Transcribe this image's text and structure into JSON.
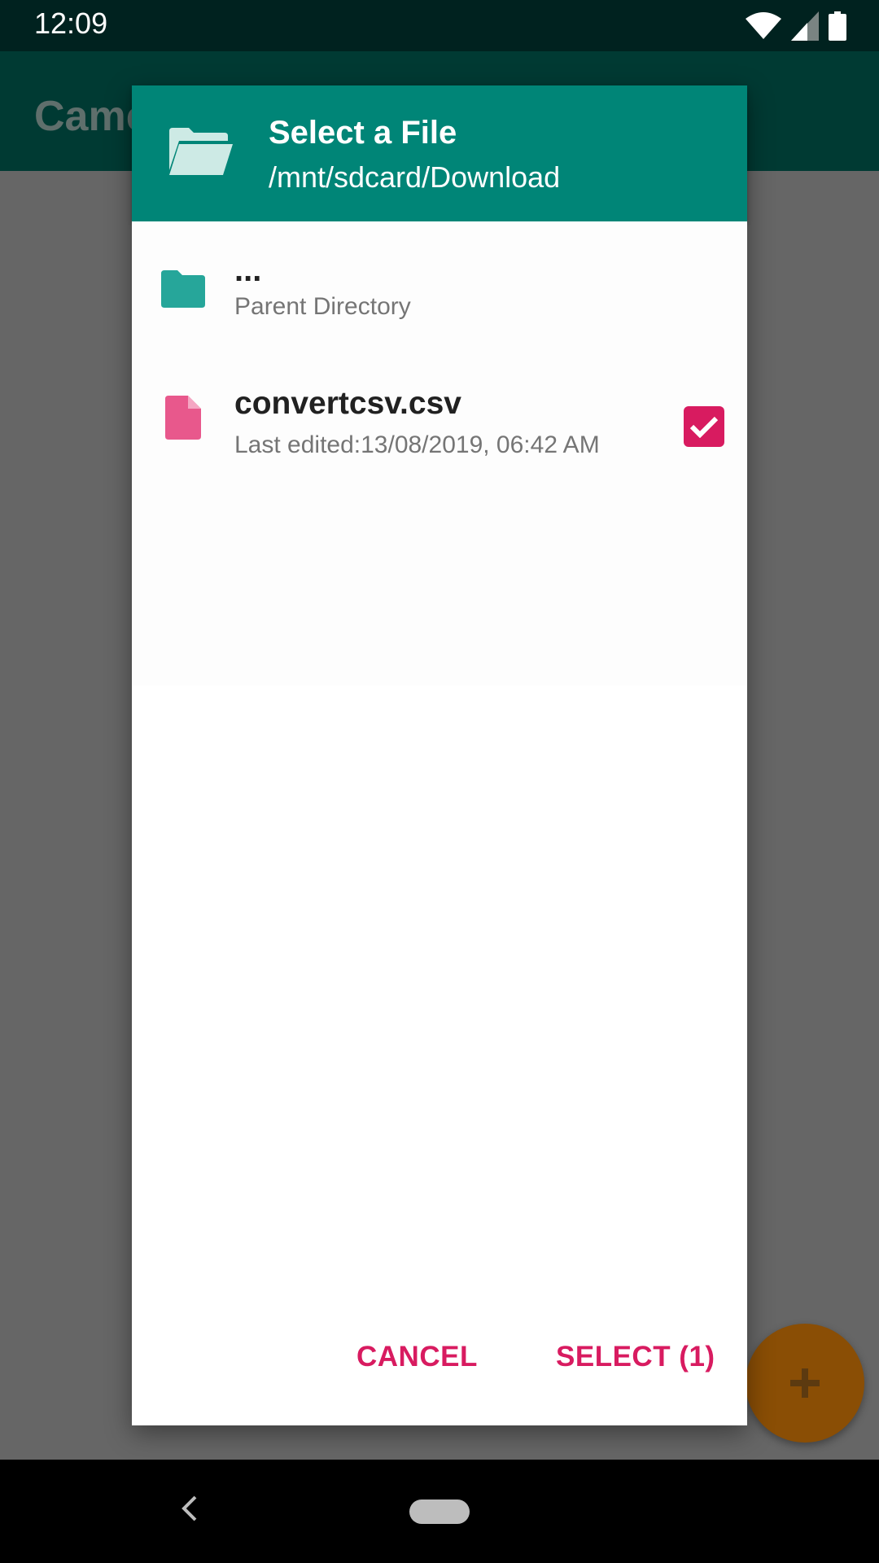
{
  "status_bar": {
    "time": "12:09",
    "icons": [
      "wifi-icon",
      "signal-icon",
      "battery-icon"
    ]
  },
  "app_bar": {
    "title": "Camera"
  },
  "dialog": {
    "title": "Select a File",
    "path": "/mnt/sdcard/Download",
    "header_icon": "folder-open-icon",
    "items": [
      {
        "name": "...",
        "subtitle": "Parent Directory",
        "icon": "folder-icon",
        "icon_color": "#26a69a"
      },
      {
        "name": "convertcsv.csv",
        "subtitle": "Last edited:13/08/2019, 06:42 AM",
        "icon": "file-icon",
        "icon_color": "#e8588c",
        "checked": true
      }
    ],
    "buttons": {
      "cancel": "CANCEL",
      "select": "SELECT (1)"
    }
  },
  "fab": {
    "icon": "plus-icon"
  },
  "nav_bar": {
    "back_icon": "back-icon",
    "home_icon": "home-pill-icon"
  },
  "colors": {
    "header": "#008577",
    "accent": "#d81b60",
    "fab": "#8a4e05"
  }
}
